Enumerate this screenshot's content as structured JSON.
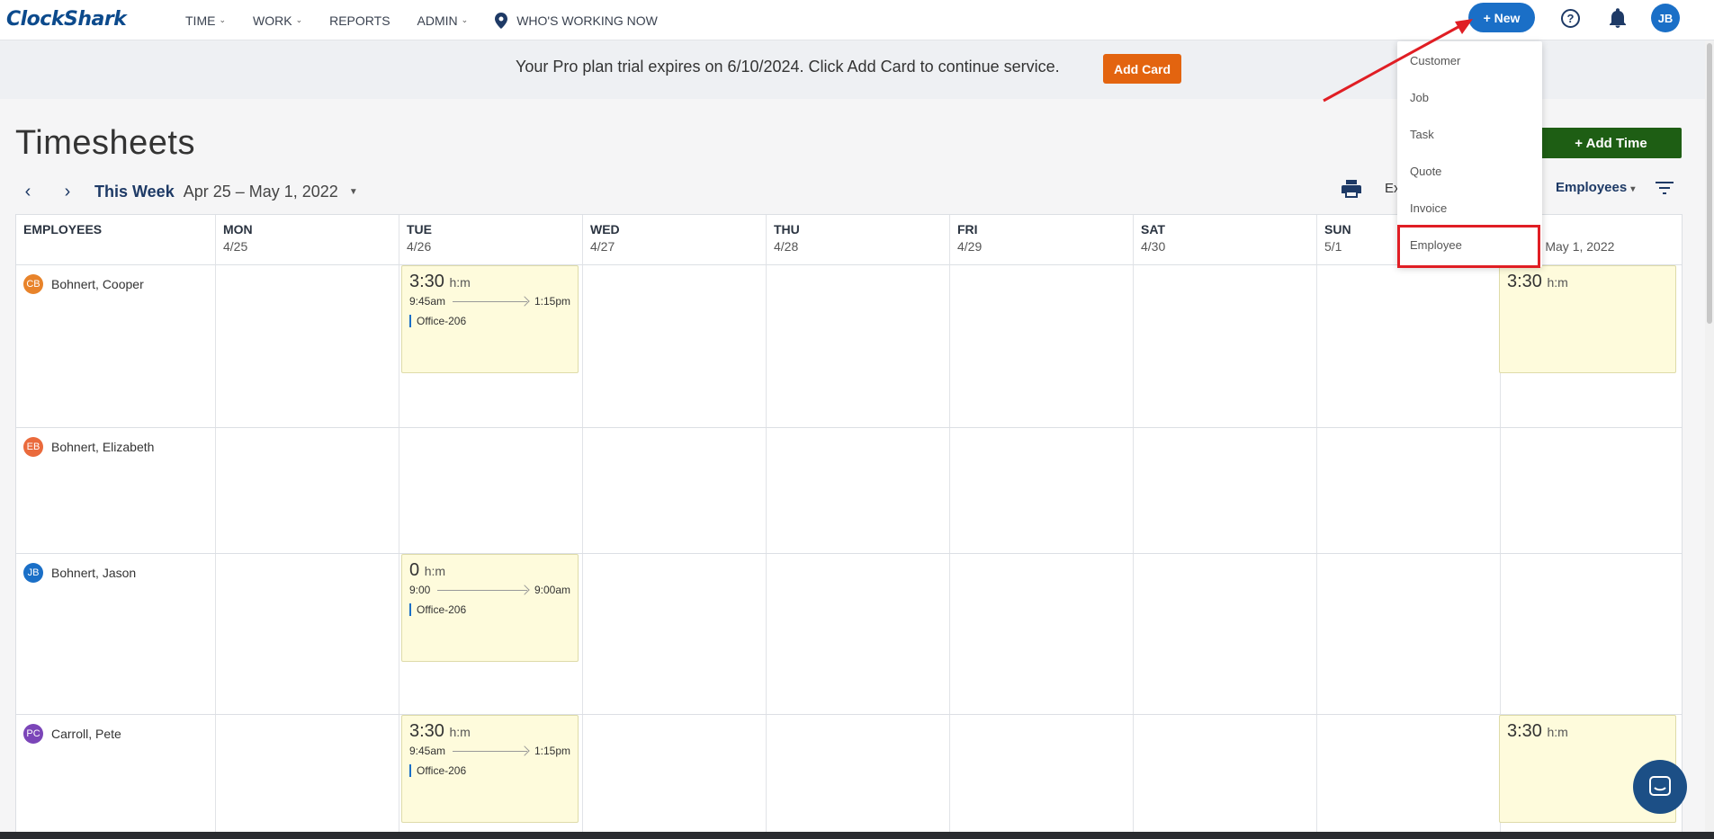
{
  "nav": {
    "logo": "ClockShark",
    "items": [
      {
        "label": "TIME",
        "dropdown": true
      },
      {
        "label": "WORK",
        "dropdown": true
      },
      {
        "label": "REPORTS",
        "dropdown": false
      },
      {
        "label": "ADMIN",
        "dropdown": true
      }
    ],
    "whos_working": "WHO'S WORKING NOW",
    "new_button": "+ New",
    "help": "?",
    "user_initials": "JB",
    "accent": "#1a6fc7"
  },
  "banner": {
    "text": "Your Pro plan trial expires on 6/10/2024. Click Add Card to continue service.",
    "button": "Add Card"
  },
  "page": {
    "title": "Timesheets",
    "add_time": "+ Add Time",
    "this_week": "This Week",
    "date_range": "Apr 25 – May 1, 2022",
    "export": "Ex",
    "employees_filter": "Employees"
  },
  "grid": {
    "employees_header": "EMPLOYEES",
    "days": [
      {
        "day": "MON",
        "date": "4/25"
      },
      {
        "day": "TUE",
        "date": "4/26"
      },
      {
        "day": "WED",
        "date": "4/27"
      },
      {
        "day": "THU",
        "date": "4/28"
      },
      {
        "day": "FRI",
        "date": "4/29"
      },
      {
        "day": "SAT",
        "date": "4/30"
      },
      {
        "day": "SUN",
        "date": "5/1"
      }
    ],
    "total_header_visible": "5 – May 1, 2022",
    "employees": [
      {
        "initials": "CB",
        "name": "Bohnert, Cooper",
        "color": "#e8832a"
      },
      {
        "initials": "EB",
        "name": "Bohnert, Elizabeth",
        "color": "#ea6a3c"
      },
      {
        "initials": "JB",
        "name": "Bohnert, Jason",
        "color": "#1a6fc7"
      },
      {
        "initials": "PC",
        "name": "Carroll, Pete",
        "color": "#7b45b8"
      }
    ],
    "entries": [
      {
        "hours": "3:30",
        "unit": "h:m",
        "start": "9:45am",
        "end": "1:15pm",
        "job": "Office-206"
      },
      {
        "hours": "0",
        "unit": "h:m",
        "start": "9:00",
        "end": "9:00am",
        "job": "Office-206"
      },
      {
        "hours": "3:30",
        "unit": "h:m",
        "start": "9:45am",
        "end": "1:15pm",
        "job": "Office-206"
      }
    ],
    "totals": [
      {
        "hours": "3:30",
        "unit": "h:m"
      },
      {
        "hours": "3:30",
        "unit": "h:m"
      }
    ]
  },
  "new_menu": {
    "items": [
      "Customer",
      "Job",
      "Task",
      "Quote",
      "Invoice",
      "Employee"
    ],
    "highlighted": "Employee",
    "highlight_color": "#e01e24"
  }
}
